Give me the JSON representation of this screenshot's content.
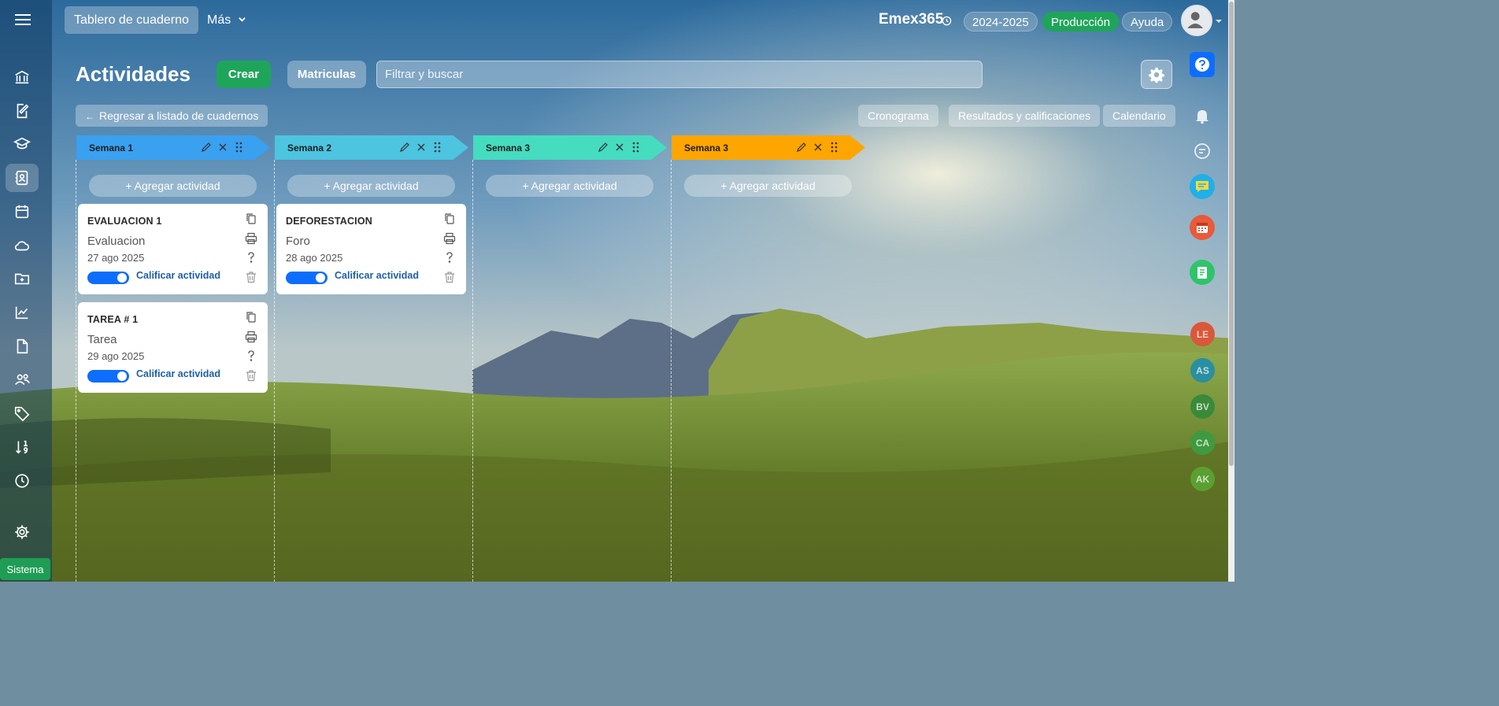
{
  "topbar": {
    "tab_label": "Tablero de cuaderno",
    "more_label": "Más",
    "brand": "Emex365",
    "year_chip": "2024-2025",
    "env_chip": "Producción",
    "help_chip": "Ayuda"
  },
  "header": {
    "title": "Actividades",
    "create_label": "Crear",
    "enroll_label": "Matriculas",
    "search_placeholder": "Filtrar y buscar"
  },
  "toolbar": {
    "back_label": "Regresar a listado de cuadernos",
    "schedule_label": "Cronograma",
    "results_label": "Resultados y calificaciones",
    "calendar_label": "Calendario"
  },
  "weeks": [
    {
      "label": "Semana 1",
      "color": "#3aa0f0",
      "add_label": "+ Agregar actividad"
    },
    {
      "label": "Semana 2",
      "color": "#4dc4e0",
      "add_label": "+ Agregar actividad"
    },
    {
      "label": "Semana 3",
      "color": "#45dcc0",
      "add_label": "+ Agregar actividad"
    },
    {
      "label": "Semana 3",
      "color": "#ffa500",
      "add_label": "+ Agregar actividad"
    }
  ],
  "cards": [
    {
      "title": "EVALUACION 1",
      "type": "Evaluacion",
      "date": "27 ago 2025",
      "grade_label": "Calificar actividad",
      "grading_enabled": true
    },
    {
      "title": "TAREA # 1",
      "type": "Tarea",
      "date": "29 ago 2025",
      "grade_label": "Calificar actividad",
      "grading_enabled": true
    },
    {
      "title": "DEFORESTACION",
      "type": "Foro",
      "date": "28 ago 2025",
      "grade_label": "Calificar actividad",
      "grading_enabled": true
    }
  ],
  "users": [
    {
      "initials": "LE",
      "color": "#d9573a"
    },
    {
      "initials": "AS",
      "color": "#2a8fa0"
    },
    {
      "initials": "BV",
      "color": "#3a8a3a"
    },
    {
      "initials": "CA",
      "color": "#3f9a3f"
    },
    {
      "initials": "AK",
      "color": "#5aa030"
    }
  ],
  "footer": {
    "system_label": "Sistema"
  },
  "colors": {
    "accent_green": "#1fa55a",
    "accent_blue": "#0d6efd"
  }
}
